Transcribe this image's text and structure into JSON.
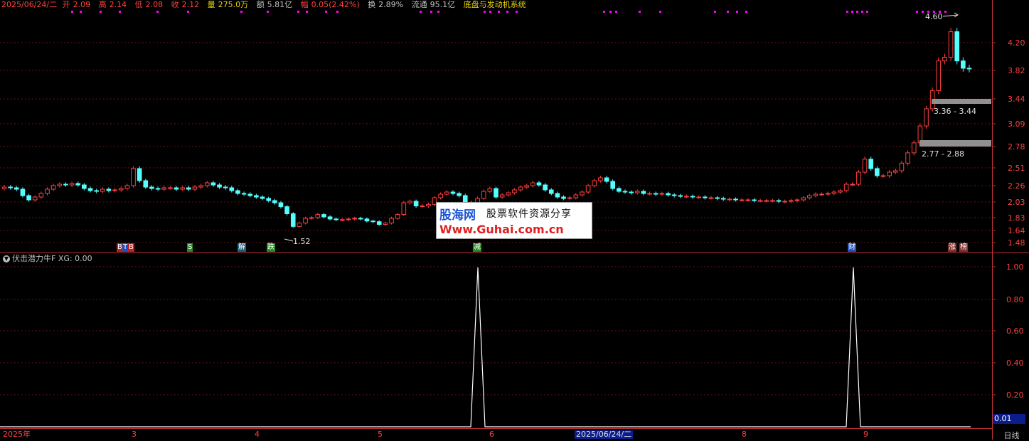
{
  "info": {
    "date": "2025/06/24/二",
    "open_label": "开",
    "open": "2.09",
    "high_label": "高",
    "high": "2.14",
    "low_label": "低",
    "low": "2.08",
    "close_label": "收",
    "close": "2.12",
    "vol_label": "量",
    "vol": "275.0万",
    "amount_label": "额",
    "amount": "5.81亿",
    "change_label": "幅",
    "change": "0.05(2.42%)",
    "turnover_label": "换",
    "turnover": "2.89%",
    "float_label": "流通",
    "float": "95.1亿",
    "system": "底盘与发动机系统"
  },
  "price_axis": {
    "ticks": [
      "4.20",
      "3.82",
      "3.44",
      "3.09",
      "2.78",
      "2.51",
      "2.26",
      "2.03",
      "1.83",
      "1.64",
      "1.48"
    ]
  },
  "annotations": {
    "high_marker": "4.60",
    "low_marker": "1.52",
    "zone_upper": "3.36 - 3.44",
    "zone_lower": "2.77 - 2.88"
  },
  "signals": [
    {
      "text": "B",
      "color": "#c02020"
    },
    {
      "text": "T",
      "color": "#2050c0"
    },
    {
      "text": "B",
      "color": "#c02020"
    },
    {
      "text": "S",
      "color": "#209020"
    },
    {
      "text": "解",
      "color": "#20607a"
    },
    {
      "text": "跌",
      "color": "#209020"
    },
    {
      "text": "减",
      "color": "#209020"
    },
    {
      "text": "财",
      "color": "#2050c0"
    },
    {
      "text": "涨",
      "color": "#803030"
    },
    {
      "text": "榜",
      "color": "#803030"
    }
  ],
  "indicator": {
    "title": "伏击潜力牛F",
    "xg_label": "XG:",
    "xg_value": "0.00",
    "axis_ticks": [
      "1.00",
      "0.80",
      "0.60",
      "0.40",
      "0.20"
    ],
    "current_value": "0.01"
  },
  "x_axis": {
    "labels": [
      "2025年",
      "3",
      "4",
      "5",
      "6",
      "2025/06/24/二",
      "8",
      "9"
    ],
    "period": "日线"
  },
  "watermark": {
    "logo": "股海网",
    "slogan": "股票软件资源分享",
    "url": "Www.Guhai.com.cn"
  },
  "colors": {
    "up": "#ff4040",
    "down": "#54ffff",
    "background": "#000000",
    "grid": "#7a1010",
    "signal_dots": "#ff00ff"
  }
}
